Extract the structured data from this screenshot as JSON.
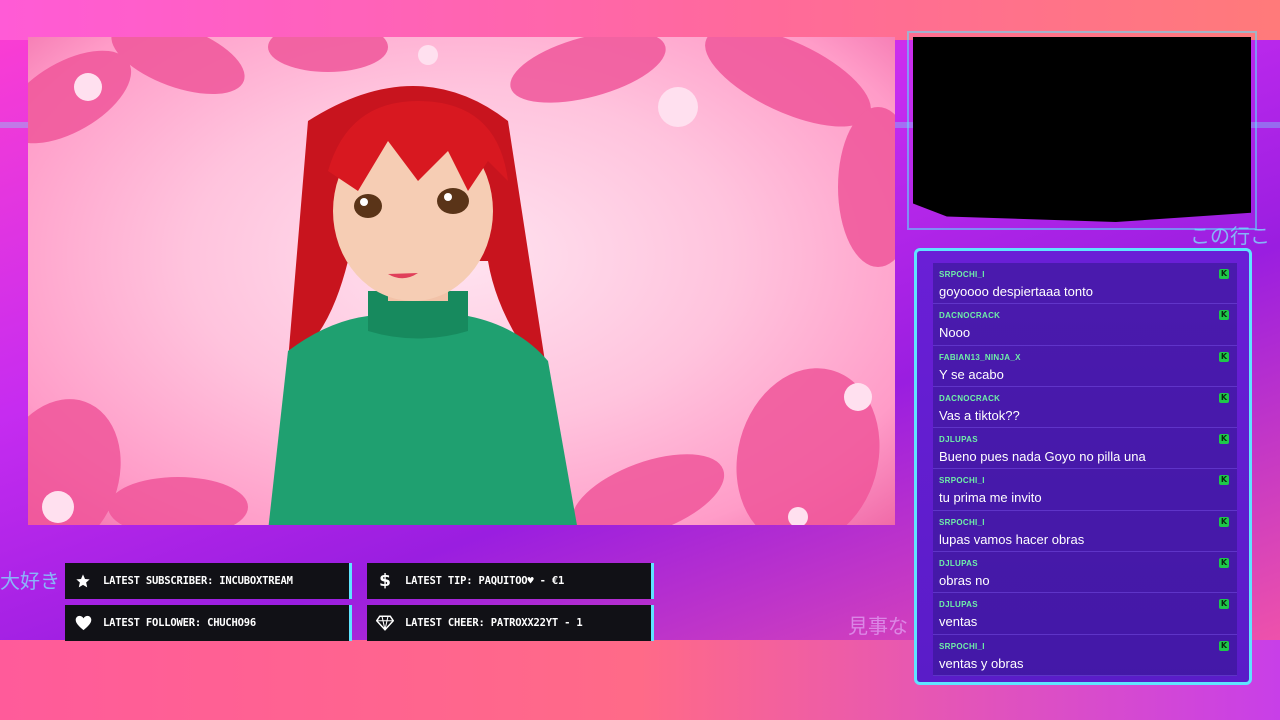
{
  "overlay": {
    "deco_left": "大好き",
    "deco_right": "この行こ",
    "deco_mid": "見事な"
  },
  "alerts": {
    "subscriber": {
      "label": "LATEST SUBSCRIBER: INCUBOXTREAM",
      "icon": "star-icon"
    },
    "tip": {
      "label": "LATEST TIP: PAQUITOO♥ - €1",
      "icon": "dollar-icon"
    },
    "follower": {
      "label": "LATEST FOLLOWER: CHUCHO96",
      "icon": "heart-icon"
    },
    "cheer": {
      "label": "LATEST CHEER: PATROXX22YT - 1",
      "icon": "diamond-icon"
    }
  },
  "chat": {
    "messages": [
      {
        "user": "SRPOCHI_I",
        "text": "goyoooo despiertaaa tonto"
      },
      {
        "user": "DACNOCRACK",
        "text": "Nooo"
      },
      {
        "user": "FABIAN13_NINJA_X",
        "text": "Y se acabo"
      },
      {
        "user": "DACNOCRACK",
        "text": "Vas a tiktok??"
      },
      {
        "user": "DJLUPAS",
        "text": "Bueno pues nada Goyo no pilla una"
      },
      {
        "user": "SRPOCHI_I",
        "text": "tu prima me invito"
      },
      {
        "user": "SRPOCHI_I",
        "text": "lupas vamos hacer obras"
      },
      {
        "user": "DJLUPAS",
        "text": "obras no"
      },
      {
        "user": "DJLUPAS",
        "text": "ventas"
      },
      {
        "user": "SRPOCHI_I",
        "text": "ventas y obras"
      }
    ],
    "badge_icon": "kick-badge-icon"
  },
  "colors": {
    "accent": "#5fe4ff",
    "username": "#6ff0a8",
    "chat_bg": "#5a1cc8",
    "alert_bg": "#111116"
  }
}
